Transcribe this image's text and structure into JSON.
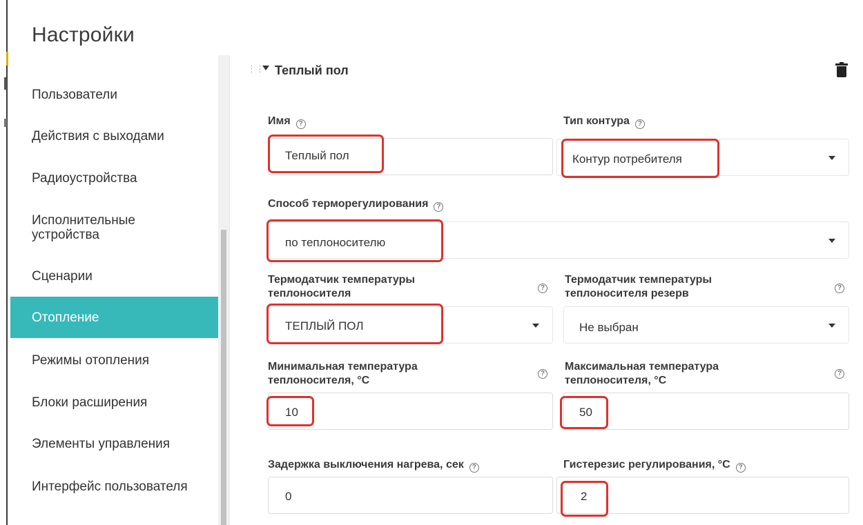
{
  "header": {
    "title": "Настройки"
  },
  "sidebar": {
    "items": [
      {
        "label": "Пользователи",
        "active": false
      },
      {
        "label": "Действия с выходами",
        "active": false
      },
      {
        "label": "Радиоустройства",
        "active": false
      },
      {
        "label": "Исполнительные устройства",
        "active": false
      },
      {
        "label": "Сценарии",
        "active": false
      },
      {
        "label": "Отопление",
        "active": true
      },
      {
        "label": "Режимы отопления",
        "active": false
      },
      {
        "label": "Блоки расширения",
        "active": false
      },
      {
        "label": "Элементы управления",
        "active": false
      },
      {
        "label": "Интерфейс пользователя",
        "active": false
      }
    ]
  },
  "section": {
    "title": "Теплый пол",
    "drag_icon": "drag-handle-icon",
    "delete_icon": "trash-icon"
  },
  "form": {
    "name": {
      "label": "Имя",
      "value": "Теплый пол"
    },
    "circuit_type": {
      "label": "Тип контура",
      "value": "Контур потребителя"
    },
    "regulation_method": {
      "label": "Способ терморегулирования",
      "value": "по теплоносителю"
    },
    "sensor": {
      "label_line1": "Термодатчик температуры",
      "label_line2": "теплоносителя",
      "value": "ТЕПЛЫЙ ПОЛ"
    },
    "sensor_reserve": {
      "label_line1": "Термодатчик температуры",
      "label_line2": "теплоносителя резерв",
      "value": "Не выбран"
    },
    "min_temp": {
      "label_line1": "Минимальная температура",
      "label_line2": "теплоносителя, °C",
      "value": "10"
    },
    "max_temp": {
      "label_line1": "Максимальная температура",
      "label_line2": "теплоносителя, °C",
      "value": "50"
    },
    "delay": {
      "label": "Задержка выключения нагрева, сек",
      "value": "0"
    },
    "hysteresis": {
      "label": "Гистерезис регулирования, °C",
      "value": "2"
    },
    "help_glyph": "?"
  },
  "colors": {
    "accent": "#37b9ba",
    "highlight": "#e0312c"
  }
}
